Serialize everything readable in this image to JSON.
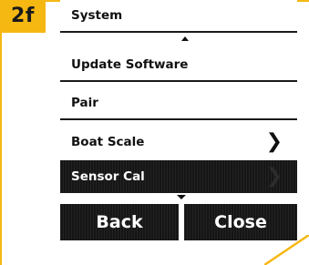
{
  "step": "2f",
  "menu": {
    "items": [
      {
        "label": "System",
        "chevron": false,
        "selected": false
      },
      {
        "label": "Update Software",
        "chevron": false,
        "selected": false
      },
      {
        "label": "Pair",
        "chevron": false,
        "selected": false
      },
      {
        "label": "Boat Scale",
        "chevron": true,
        "selected": false
      },
      {
        "label": "Sensor Cal",
        "chevron": true,
        "selected": true
      }
    ]
  },
  "buttons": {
    "back": "Back",
    "close": "Close"
  },
  "colors": {
    "accent": "#f5b712",
    "selected_bg": "#161616",
    "text": "#111111"
  },
  "icons": {
    "chevron": "chevron-right-icon",
    "scroll_up": "scroll-up-icon",
    "scroll_down": "scroll-down-icon"
  }
}
